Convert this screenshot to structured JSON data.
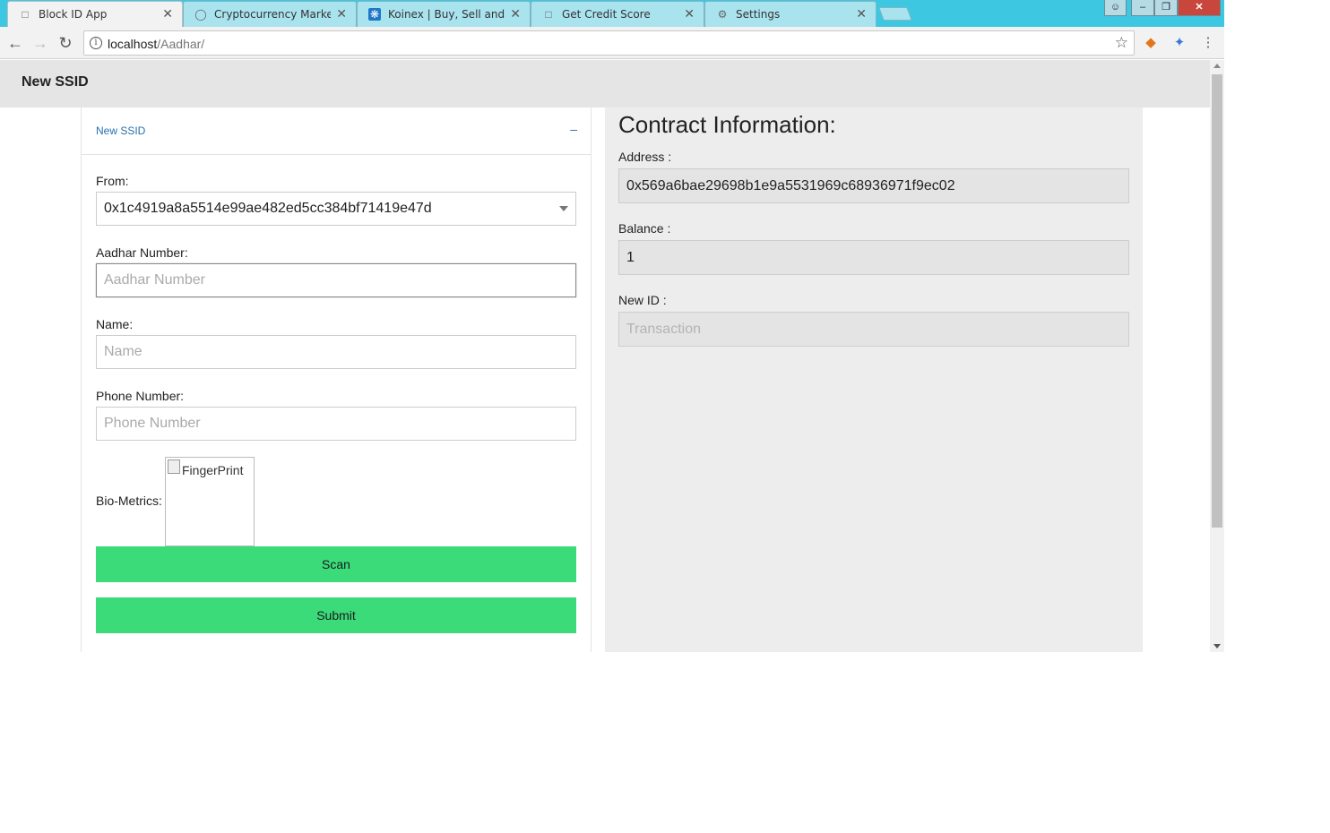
{
  "tabs": [
    {
      "title": "Block ID App",
      "icon": "page-icon",
      "active": true
    },
    {
      "title": "Cryptocurrency Market C",
      "icon": "coin-icon",
      "active": false
    },
    {
      "title": "Koinex | Buy, Sell and Tra",
      "icon": "koinex-icon",
      "active": false
    },
    {
      "title": "Get Credit Score",
      "icon": "page-icon",
      "active": false
    },
    {
      "title": "Settings",
      "icon": "gear-icon",
      "active": false
    }
  ],
  "omnibox": {
    "host": "localhost",
    "path": "/Aadhar/"
  },
  "app": {
    "title": "New SSID"
  },
  "card": {
    "title": "New SSID",
    "collapse_symbol": "–"
  },
  "form": {
    "from_label": "From:",
    "from_value": "0x1c4919a8a5514e99ae482ed5cc384bf71419e47d",
    "aadhar_label": "Aadhar Number:",
    "aadhar_placeholder": "Aadhar Number",
    "name_label": "Name:",
    "name_placeholder": "Name",
    "phone_label": "Phone Number:",
    "phone_placeholder": "Phone Number",
    "bio_label": "Bio-Metrics:",
    "bio_alt": "FingerPrint",
    "scan_label": "Scan",
    "submit_label": "Submit"
  },
  "contract": {
    "title": "Contract Information:",
    "address_label": "Address :",
    "address_value": "0x569a6bae29698b1e9a5531969c68936971f9ec02",
    "balance_label": "Balance :",
    "balance_value": "1",
    "newid_label": "New ID :",
    "newid_placeholder": "Transaction"
  },
  "colors": {
    "titlebar": "#3ec7e0",
    "button_green": "#3bdb7a",
    "link_blue": "#2a6fb0"
  }
}
